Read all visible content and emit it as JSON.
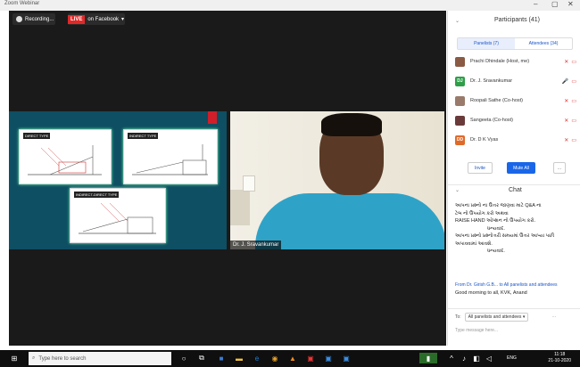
{
  "window": {
    "title": "Zoom Webinar"
  },
  "top_controls": {
    "recording": "Recording...",
    "live_badge": "LIVE",
    "live_target": "on Facebook"
  },
  "slide": {
    "cards": [
      "DIRECT TYPE",
      "INDIRECT TYPE",
      "INDIRECT-DIRECT TYPE"
    ]
  },
  "video": {
    "name": "Dr. J. Sravankumar"
  },
  "participants": {
    "header": "Participants (41)",
    "tabs": [
      "Panelists (7)",
      "Attendees (34)"
    ],
    "list": [
      {
        "name": "Prachi Dhindale (Host, me)",
        "avatar_color": "#8a5a44",
        "initials": ""
      },
      {
        "name": "Dr. J. Sravankumar",
        "avatar_color": "#2e9e49",
        "initials": "DJ"
      },
      {
        "name": "Roopali Sathe (Co-host)",
        "avatar_color": "#9a7a6a",
        "initials": ""
      },
      {
        "name": "Sangeeta (Co-host)",
        "avatar_color": "#6a3a3a",
        "initials": ""
      },
      {
        "name": "Dr. D K Vyas",
        "avatar_color": "#e06a2a",
        "initials": "DD"
      }
    ],
    "invite": "Invite",
    "mute_all": "Mute All",
    "more": "..."
  },
  "chat": {
    "header": "Chat",
    "lines": [
      "આપના પ્રશ્નો ના ઉત્તર જાણવા માટે Q&A ના",
      "ટેબ નો ઉપયોગ કરો અથવા",
      "RAISE HAND ઓપ્શન નો ઉપયોગ કરો.",
      "ધન્યવાદ.",
      "આપના પ્રશ્નો પ્રશ્નોત્તરી સમયમાં ઉત્તર આપ્યા પછી",
      "અપાવવામાં આવશે.",
      "ધન્યવાદ."
    ],
    "from": "From Dr. Girish G.B... to All panelists and attendees",
    "message": "Good morning to all, KVK, Anand",
    "to_label": "To:",
    "to_value": "All panelists and attendees",
    "placeholder": "Type message here..."
  },
  "taskbar": {
    "search_placeholder": "Type here to search",
    "time": "11:18",
    "date": "21-10-2020",
    "language": "ENG"
  }
}
